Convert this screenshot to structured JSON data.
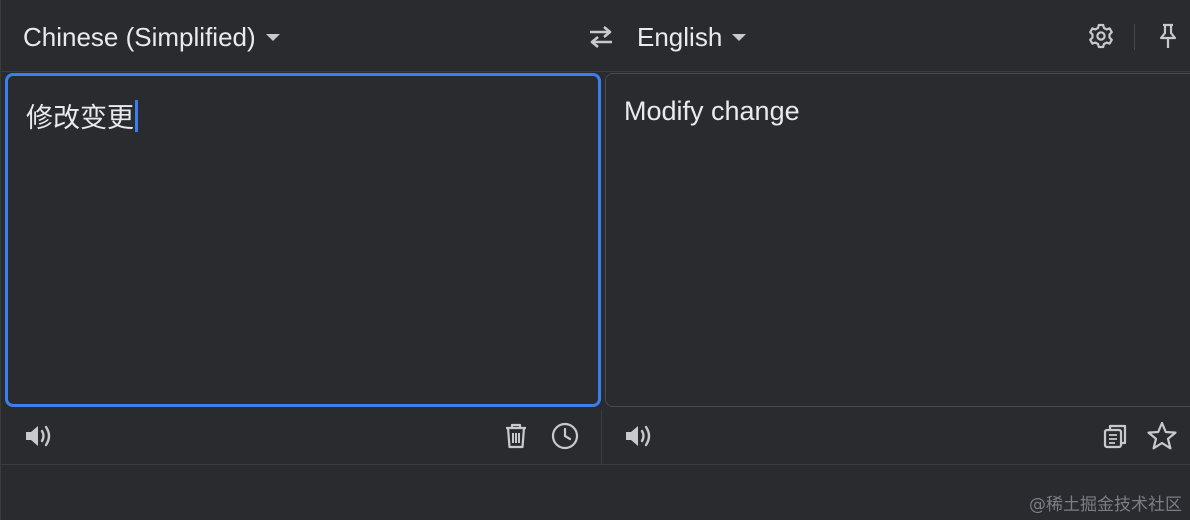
{
  "header": {
    "source_language": "Chinese (Simplified)",
    "target_language": "English",
    "icons": {
      "swap": "swap-arrows-icon",
      "settings": "gear-icon",
      "pin": "pin-icon"
    }
  },
  "source": {
    "text": "修改变更",
    "icons": {
      "listen": "speaker-icon",
      "clear": "trash-icon",
      "history": "clock-icon"
    }
  },
  "target": {
    "text": "Modify change",
    "icons": {
      "listen": "speaker-icon",
      "copy": "copy-icon",
      "favorite": "star-icon"
    }
  },
  "watermark": "@稀土掘金技术社区",
  "colors": {
    "background": "#2a2b2f",
    "accent": "#3b7ef0",
    "text": "#e8eaed",
    "icon": "#c7c9cc"
  }
}
